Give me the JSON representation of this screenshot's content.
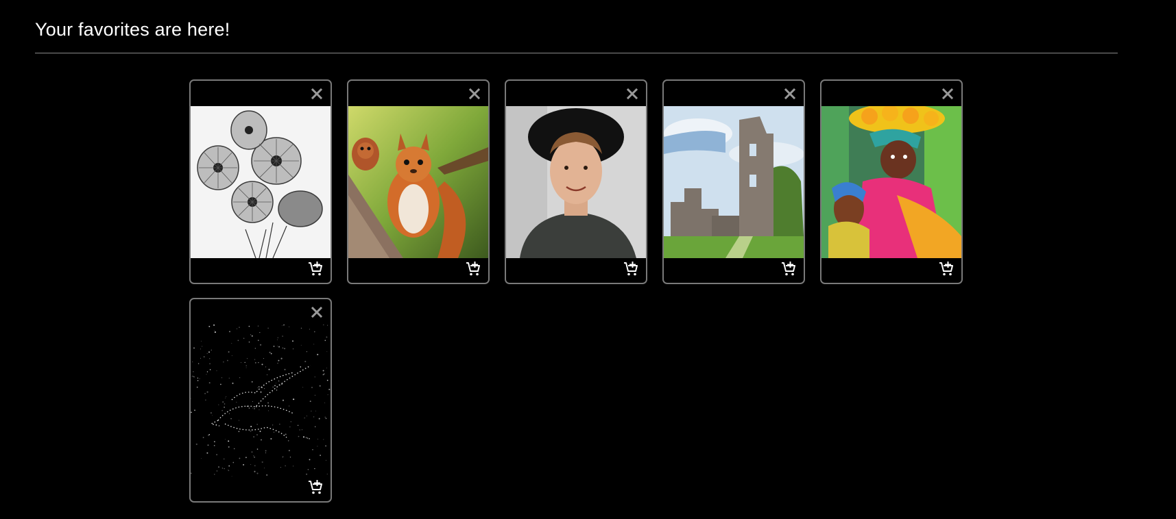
{
  "page": {
    "title": "Your favorites are here!"
  },
  "favorites": [
    {
      "subject": "pencil-flowers",
      "remove_icon": "close-icon",
      "cart_icon": "add-to-cart-icon"
    },
    {
      "subject": "squirrels",
      "remove_icon": "close-icon",
      "cart_icon": "add-to-cart-icon"
    },
    {
      "subject": "man-with-hat",
      "remove_icon": "close-icon",
      "cart_icon": "add-to-cart-icon"
    },
    {
      "subject": "castle-ruins",
      "remove_icon": "close-icon",
      "cart_icon": "add-to-cart-icon"
    },
    {
      "subject": "market-woman-painting",
      "remove_icon": "close-icon",
      "cart_icon": "add-to-cart-icon"
    },
    {
      "subject": "starry-bird",
      "remove_icon": "close-icon",
      "cart_icon": "add-to-cart-icon"
    }
  ],
  "colors": {
    "background": "#000000",
    "card_border": "#7a7a7a",
    "remove_icon": "#9a9a9a",
    "cart_icon": "#ffffff",
    "title_rule": "#8a8a8a"
  }
}
